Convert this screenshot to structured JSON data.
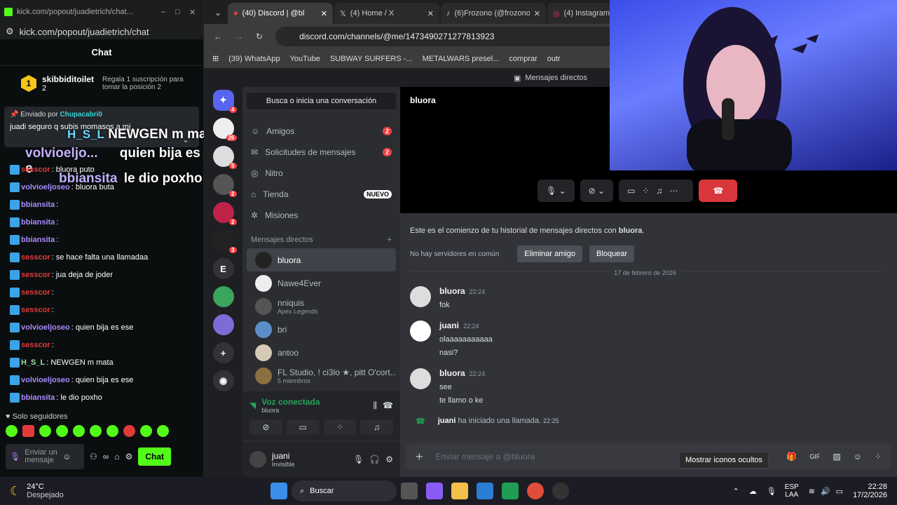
{
  "kick": {
    "title": "kick.com/popout/juadietrich/chat...",
    "url": "kick.com/popout/juadietrich/chat",
    "chat_title": "Chat",
    "top_gifter": {
      "rank": "1",
      "name": "skibbiditoilet",
      "count": "2"
    },
    "gift_cta": "Regala 1 suscripción para tomar la posición 2",
    "pinned_by": "Enviado por",
    "pinned_user": "Chupacabri0",
    "pinned_text": "juadi seguro q subis momasos a mj",
    "overlay_lines": [
      "H_S_L",
      "NEWGEN m mata",
      "volvioeljo...",
      "quien bija es e",
      "bbiansita",
      "le dio poxho"
    ],
    "messages": [
      {
        "user": "sesscor",
        "color": "#e03b3b",
        "text": ": bluora puto"
      },
      {
        "user": "volvioeljoseo",
        "color": "#a78bfa",
        "text": ": bluora buta"
      },
      {
        "user": "bbiansita",
        "color": "#a78bfa",
        "text": ":"
      },
      {
        "user": "bbiansita",
        "color": "#a78bfa",
        "text": ":"
      },
      {
        "user": "bbiansita",
        "color": "#a78bfa",
        "text": ":"
      },
      {
        "user": "sesscor",
        "color": "#e03b3b",
        "text": ": se hace falta una llamadaa"
      },
      {
        "user": "sesscor",
        "color": "#e03b3b",
        "text": ": jua deja de joder"
      },
      {
        "user": "sesscor",
        "color": "#e03b3b",
        "text": ":"
      },
      {
        "user": "sesscor",
        "color": "#e03b3b",
        "text": ":"
      },
      {
        "user": "volvioeljoseo",
        "color": "#a78bfa",
        "text": ": quien bija es ese"
      },
      {
        "user": "sesscor",
        "color": "#e03b3b",
        "text": ":"
      },
      {
        "user": "H_S_L",
        "color": "#9be3a0",
        "text": ": NEWGEN m mata"
      },
      {
        "user": "volvioeljoseo",
        "color": "#a78bfa",
        "text": ": quien bija es ese"
      },
      {
        "user": "bbiansita",
        "color": "#a78bfa",
        "text": ": le dio poxho"
      }
    ],
    "followers_only": "Solo seguidores",
    "input_placeholder": "Enviar un mensaje",
    "send_label": "Chat",
    "accent": "#53fc18"
  },
  "browser": {
    "tabs": [
      "(40) Discord | @bl",
      "(4) Home / X",
      "(6)Frozono (@frozono",
      "(4) Instagram"
    ],
    "url": "discord.com/channels/@me/1473490271277813923",
    "bookmarks": [
      "(39) WhatsApp",
      "YouTube",
      "SUBWAY SURFERS -...",
      "METALWARS presel...",
      "comprar",
      "outr"
    ]
  },
  "discord": {
    "top_label": "Mensajes directos",
    "search": "Busca o inicia una conversación",
    "nav": [
      {
        "label": "Amigos",
        "badge": "2"
      },
      {
        "label": "Solicitudes de mensajes",
        "badge": "2"
      },
      {
        "label": "Nitro",
        "badge": ""
      },
      {
        "label": "Tienda",
        "badge": "NUEVO"
      },
      {
        "label": "Misiones",
        "badge": ""
      }
    ],
    "dm_header": "Mensajes directos",
    "dms": [
      {
        "name": "bluora",
        "sub": ""
      },
      {
        "name": "Nawe4Ever",
        "sub": ""
      },
      {
        "name": "nniquis",
        "sub": "Apex Legends"
      },
      {
        "name": "bri",
        "sub": ""
      },
      {
        "name": "antoo",
        "sub": ""
      },
      {
        "name": "FL Studio, ! ci3lo ★, pitt O'cort...",
        "sub": "5 miembros"
      }
    ],
    "voice": {
      "status": "Voz conectada",
      "channel": "bluora"
    },
    "user": {
      "name": "juani",
      "status": "Invisible"
    },
    "guild_badges": [
      "4",
      "26",
      "5",
      "2",
      "2",
      "3"
    ],
    "guild_letter": "E",
    "channel_name": "bluora",
    "intro": "Este es el comienzo de tu historial de mensajes directos con",
    "intro_name": "bluora",
    "no_servers": "No hay servidores en común",
    "remove_friend": "Eliminar amigo",
    "block": "Bloquear",
    "date": "17 de febrero de 2026",
    "messages": [
      {
        "author": "bluora",
        "time": "22:24",
        "lines": [
          "fok"
        ]
      },
      {
        "author": "juani",
        "time": "22:24",
        "lines": [
          "olaaaaaaaaaaa",
          "nasi?"
        ]
      },
      {
        "author": "bluora",
        "time": "22:24",
        "lines": [
          "see",
          "te llamo o ke"
        ]
      }
    ],
    "call_user": "juani",
    "call_text": "ha iniciado una llamada.",
    "call_time": "22:25",
    "composer_placeholder": "Enviar mensaje a @bluora",
    "tooltip": "Mostrar iconos ocultos"
  },
  "taskbar": {
    "weather_temp": "24°C",
    "weather_desc": "Despejado",
    "search": "Buscar",
    "lang": "ESP",
    "lang2": "LAA",
    "time": "22:28",
    "date": "17/2/2026"
  }
}
